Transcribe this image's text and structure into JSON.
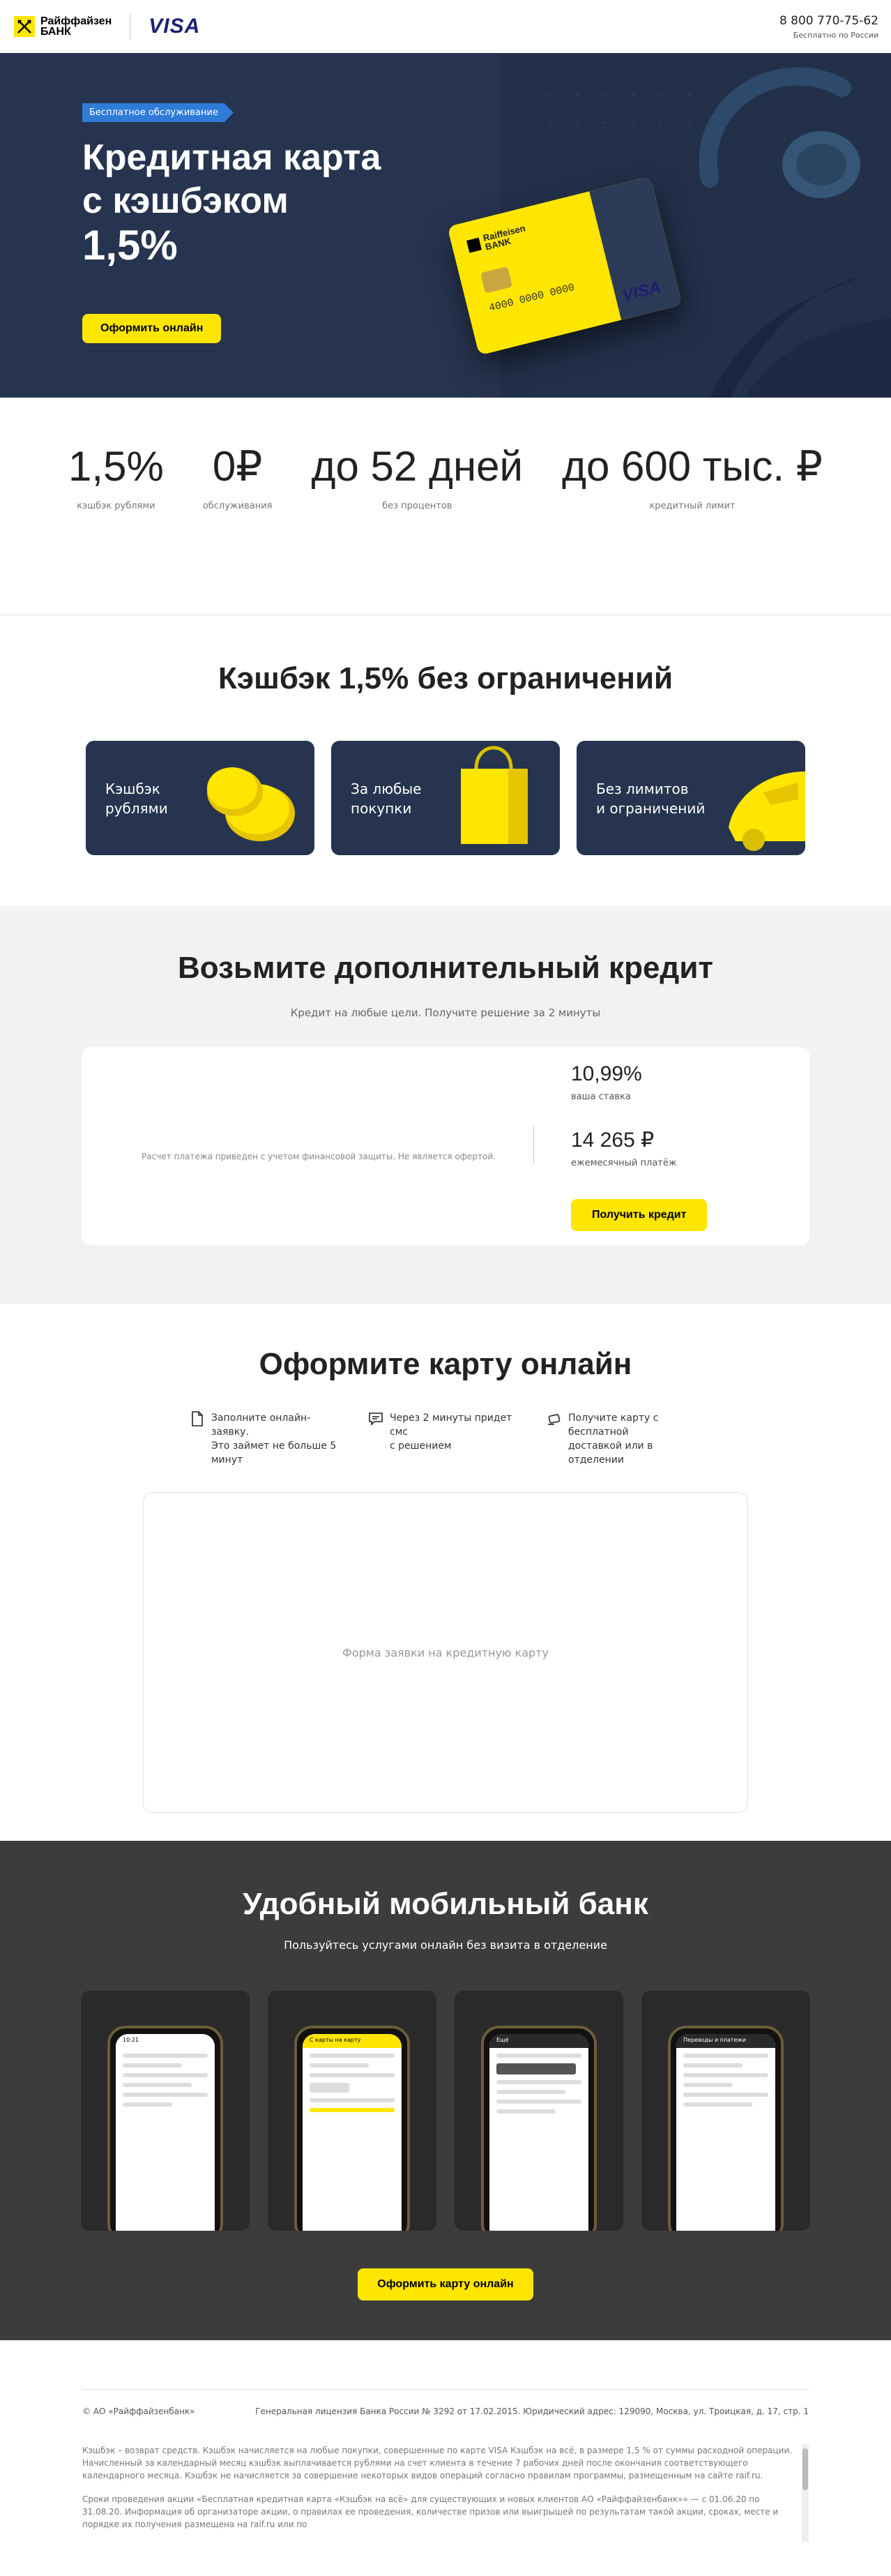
{
  "header": {
    "logo_line1": "Райффайзен",
    "logo_line2": "БАНК",
    "visa": "VISA",
    "phone": "8 800 770-75-62",
    "phone_note": "Бесплатно по России"
  },
  "hero": {
    "badge": "Бесплатное обслуживание",
    "title_line1": "Кредитная карта",
    "title_line2": "с кэшбэком",
    "title_pct": "1,5%",
    "cta": "Оформить онлайн",
    "card_bank_line1": "Raiffeisen",
    "card_bank_line2": "BANK",
    "card_number": "4000  0000  0000",
    "card_visa": "VISA"
  },
  "stats": [
    {
      "value": "1,5%",
      "label": "кэшбэк рублями"
    },
    {
      "value": "0₽",
      "label": "обслуживания"
    },
    {
      "value": "до 52 дней",
      "label": "без процентов"
    },
    {
      "value": "до 600 тыс. ₽",
      "label": "кредитный лимит"
    }
  ],
  "cashback": {
    "title": "Кэшбэк 1,5% без ограничений",
    "tiles": [
      {
        "line1": "Кэшбэк",
        "line2": "рублями",
        "icon": "coins-icon"
      },
      {
        "line1": "За любые",
        "line2": "покупки",
        "icon": "shopping-bag-icon"
      },
      {
        "line1": "Без лимитов",
        "line2": "и ограничений",
        "icon": "car-icon"
      }
    ]
  },
  "credit": {
    "title": "Возьмите дополнительный кредит",
    "subtitle": "Кредит на любые цели. Получите решение за 2 минуты",
    "calc_note": "Расчет платежа приведен с учетом финансовой защиты. Не является офертой.",
    "rate_value": "10,99%",
    "rate_label": "ваша ставка",
    "payment_value": "14 265 ₽",
    "payment_label": "ежемесячный платёж",
    "cta": "Получить кредит"
  },
  "online": {
    "title": "Оформите карту онлайн",
    "steps": [
      {
        "line1": "Заполните онлайн-заявку.",
        "line2": "Это займет не больше 5 минут",
        "icon": "document-icon"
      },
      {
        "line1": "Через 2 минуты придет смс",
        "line2": "с решением",
        "icon": "sms-icon"
      },
      {
        "line1": "Получите карту с бесплатной",
        "line2": "доставкой или в отделении",
        "icon": "delivery-icon"
      }
    ],
    "form_placeholder": "Форма заявки на кредитную карту"
  },
  "mobile": {
    "title": "Удобный мобильный банк",
    "subtitle": "Пользуйтесь услугами онлайн без визита в отделение",
    "screens": [
      {
        "bar": "10:21",
        "accent": "#ffffff"
      },
      {
        "bar": "С карты на карту",
        "accent": "#fee600"
      },
      {
        "bar": "Ещё",
        "accent": "#2a2a2a"
      },
      {
        "bar": "Переводы и платежи",
        "accent": "#2a2a2a"
      }
    ],
    "cta": "Оформить карту онлайн"
  },
  "footer": {
    "left": "© АО «Райффайзенбанк»",
    "right": "Генеральная лицензия Банка России № 3292 от 17.02.2015. Юридический адрес: 129090, Москва, ул. Троицкая, д. 17, стр. 1",
    "text1": "Кэшбэк – возврат средств. Кэшбэк начисляется на любые покупки, совершенные по карте VISA Кэшбэк на всё, в размере 1,5 % от суммы расходной операции. Начисленный за календарный месяц кэшбэк выплачивается рублями на счет клиента в течение 7 рабочих дней после окончания соответствующего календарного месяца. Кэшбэк не начисляется за совершение некоторых видов операций согласно правилам программы, размещенным на сайте raif.ru.",
    "text2": "Сроки проведения акции «Бесплатная кредитная карта «Кэшбэк на всё» для существующих и новых клиентов АО «Райффайзенбанк»» — с 01.06.20 по 31.08.20. Информация об организаторе акции, о правилах ее проведения, количестве призов или выигрышей по результатам такой акции, сроках, месте и порядке их получения размещена на raif.ru или по"
  }
}
